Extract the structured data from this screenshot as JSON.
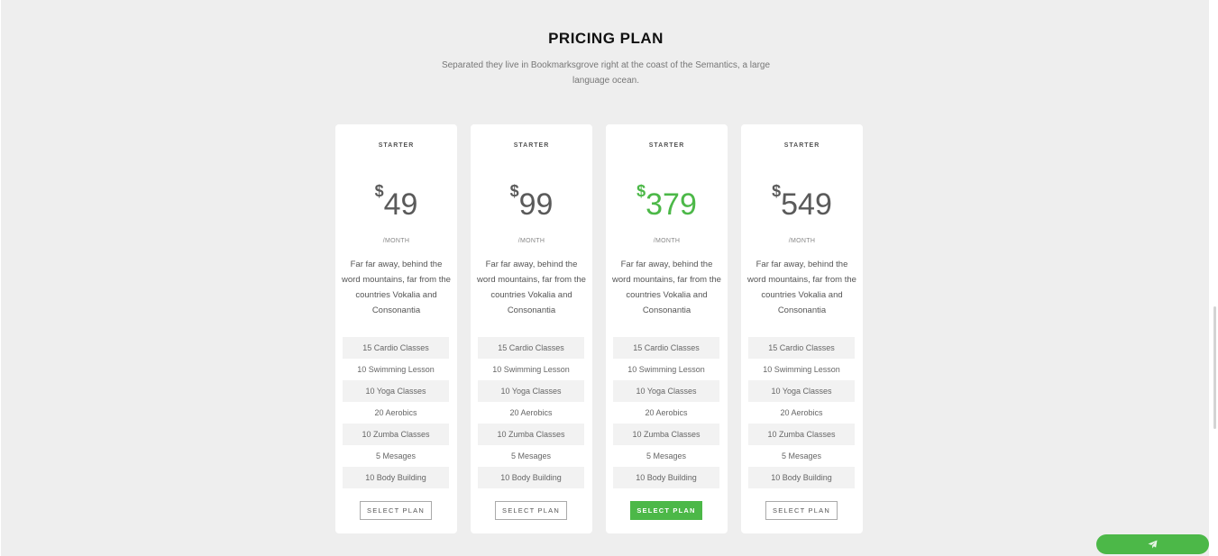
{
  "section": {
    "title": "PRICING PLAN",
    "subtitle": "Separated they live in Bookmarksgrove right at the coast of the Semantics, a large language ocean."
  },
  "plans": [
    {
      "tier": "STARTER",
      "currency": "$",
      "amount": "49",
      "period": "/MONTH",
      "description": "Far far away, behind the word mountains, far from the countries Vokalia and Consonantia",
      "features": [
        "15 Cardio Classes",
        "10 Swimming Lesson",
        "10 Yoga Classes",
        "20 Aerobics",
        "10 Zumba Classes",
        "5 Mesages",
        "10 Body Building"
      ],
      "button": "SELECT PLAN",
      "featured": false
    },
    {
      "tier": "STARTER",
      "currency": "$",
      "amount": "99",
      "period": "/MONTH",
      "description": "Far far away, behind the word mountains, far from the countries Vokalia and Consonantia",
      "features": [
        "15 Cardio Classes",
        "10 Swimming Lesson",
        "10 Yoga Classes",
        "20 Aerobics",
        "10 Zumba Classes",
        "5 Mesages",
        "10 Body Building"
      ],
      "button": "SELECT PLAN",
      "featured": false
    },
    {
      "tier": "STARTER",
      "currency": "$",
      "amount": "379",
      "period": "/MONTH",
      "description": "Far far away, behind the word mountains, far from the countries Vokalia and Consonantia",
      "features": [
        "15 Cardio Classes",
        "10 Swimming Lesson",
        "10 Yoga Classes",
        "20 Aerobics",
        "10 Zumba Classes",
        "5 Mesages",
        "10 Body Building"
      ],
      "button": "SELECT PLAN",
      "featured": true
    },
    {
      "tier": "STARTER",
      "currency": "$",
      "amount": "549",
      "period": "/MONTH",
      "description": "Far far away, behind the word mountains, far from the countries Vokalia and Consonantia",
      "features": [
        "15 Cardio Classes",
        "10 Swimming Lesson",
        "10 Yoga Classes",
        "20 Aerobics",
        "10 Zumba Classes",
        "5 Mesages",
        "10 Body Building"
      ],
      "button": "SELECT PLAN",
      "featured": false
    }
  ],
  "floating_button": {
    "icon": "paper-plane-icon"
  },
  "colors": {
    "accent": "#4cb848",
    "background": "#eeeeee",
    "card": "#ffffff",
    "price": "#5a5a5a"
  }
}
